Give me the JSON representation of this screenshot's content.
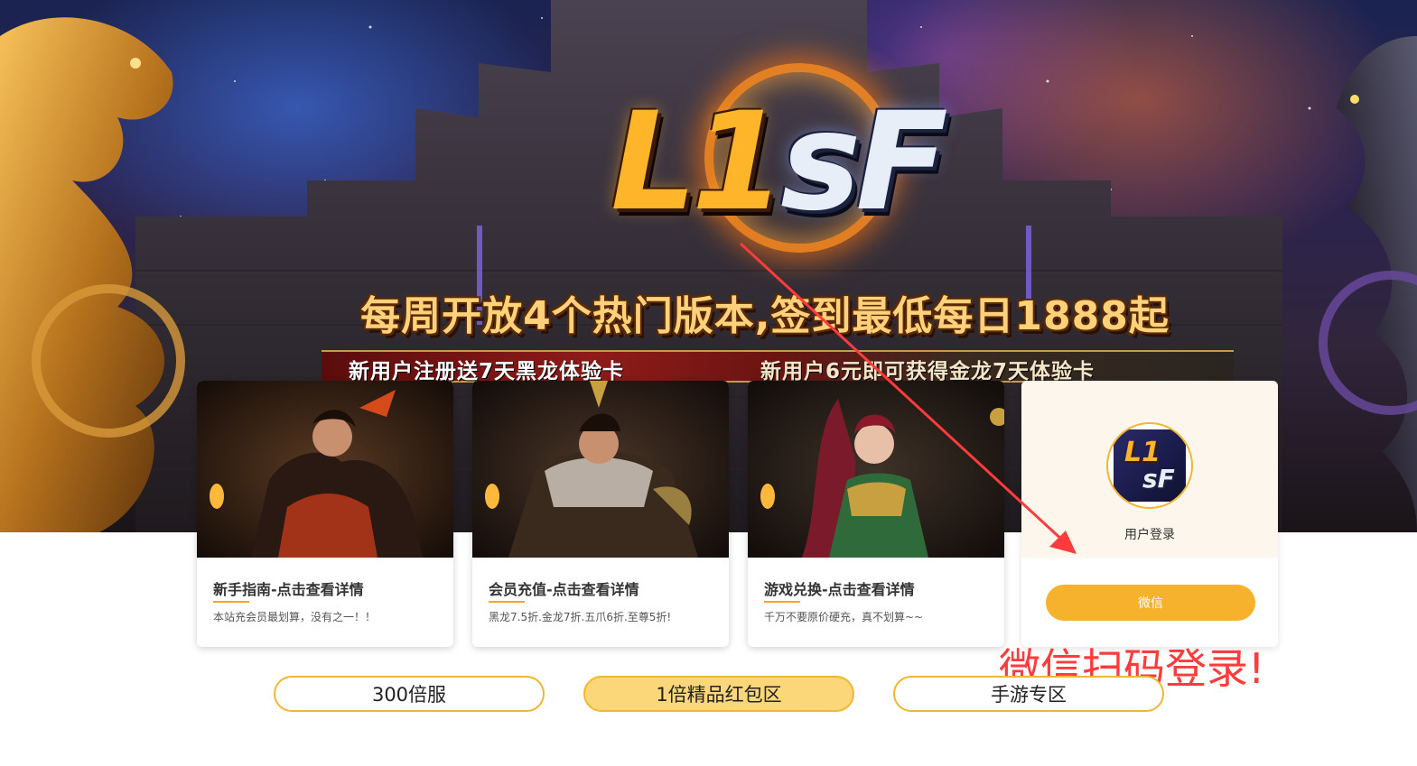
{
  "hero": {
    "logo_left": "L1",
    "logo_right": "sF",
    "headline": "每周开放4个热门版本,签到最低每日1888起",
    "promo_left": "新用户注册送7天黑龙体验卡",
    "promo_right": "新用户6元即可获得金龙7天体验卡"
  },
  "cards": [
    {
      "title": "新手指南-点击查看详情",
      "desc": "本站充会员最划算，没有之一！！"
    },
    {
      "title": "会员充值-点击查看详情",
      "desc": "黑龙7.5折.金龙7折.五爪6折.至尊5折!"
    },
    {
      "title": "游戏兑换-点击查看详情",
      "desc": "千万不要原价硬充，真不划算~~"
    }
  ],
  "login": {
    "logo_top": "L1",
    "logo_bottom": "sF",
    "label": "用户登录",
    "button": "微信"
  },
  "annotation": "微信扫码登录!",
  "tabs": [
    {
      "label": "300倍服",
      "active": false
    },
    {
      "label": "1倍精品红包区",
      "active": true
    },
    {
      "label": "手游专区",
      "active": false
    }
  ],
  "colors": {
    "accent": "#f6b22c",
    "annotation": "#ff3b3b",
    "tab_active": "#fcd77a"
  }
}
